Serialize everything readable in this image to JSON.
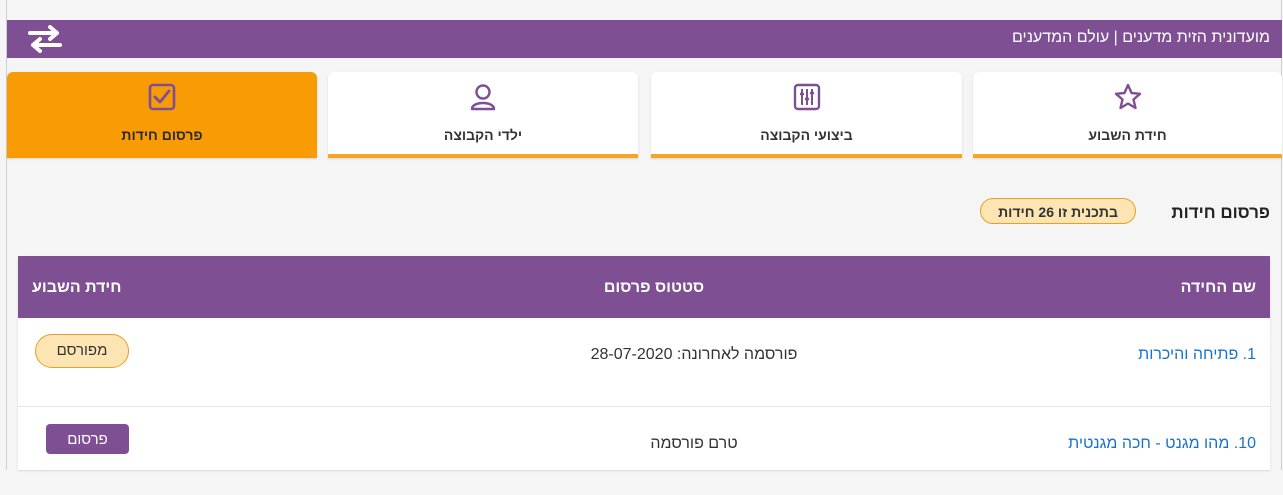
{
  "header": {
    "title": "מועדונית הזית מדענים | עולם המדענים",
    "swap_icon": "swap-arrows-icon"
  },
  "tabs": [
    {
      "label": "חידת השבוע",
      "icon": "star-icon",
      "active": false
    },
    {
      "label": "ביצועי הקבוצה",
      "icon": "sliders-icon",
      "active": false
    },
    {
      "label": "ילדי הקבוצה",
      "icon": "user-icon",
      "active": false
    },
    {
      "label": "פרסום חידות",
      "icon": "checkbox-icon",
      "active": true
    }
  ],
  "section": {
    "title": "פרסום חידות",
    "count_badge": "בתכנית זו 26 חידות"
  },
  "table": {
    "columns": [
      "שם החידה",
      "סטטוס פרסום",
      "חידת השבוע"
    ],
    "rows": [
      {
        "name": "1. פתיחה והיכרות",
        "status": "פורסמה לאחרונה: 28-07-2020",
        "action": "מפורסם"
      },
      {
        "name": "10. מהו מגנט - חכה מגנטית",
        "status": "טרם פורסמה",
        "action": "פרסום"
      }
    ]
  },
  "colors": {
    "brand_purple": "#7f4f93",
    "accent_orange": "#f99b05",
    "link_blue": "#1a73c8"
  }
}
